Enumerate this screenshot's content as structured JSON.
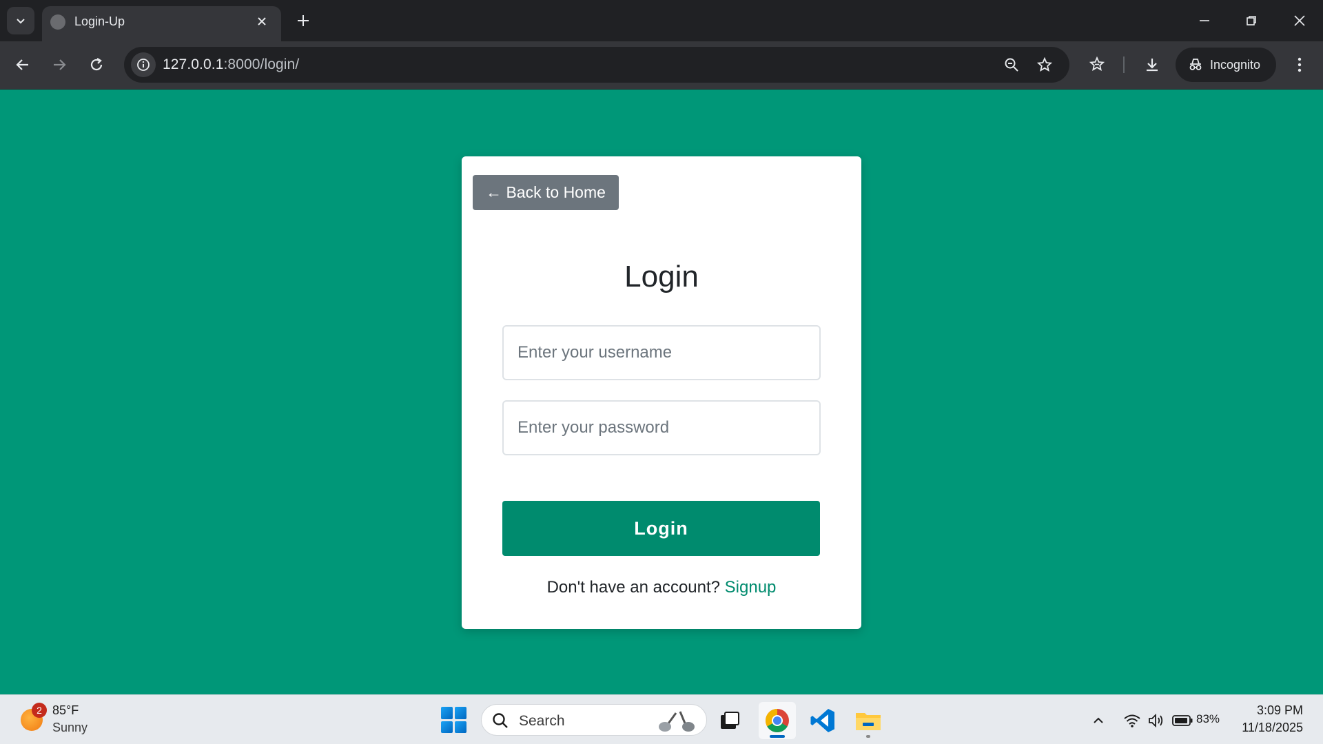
{
  "browser": {
    "tab_title": "Login-Up",
    "url_host": "127.0.0.1",
    "url_path": ":8000/login/",
    "incognito_label": "Incognito"
  },
  "page": {
    "background_color": "#009778",
    "back_button_label": "← Back to Home",
    "title": "Login",
    "username_placeholder": "Enter your username",
    "password_placeholder": "Enter your password",
    "submit_label": "Login",
    "signup_prompt": "Don't have an account? ",
    "signup_link": "Signup",
    "accent_color": "#008b6e"
  },
  "taskbar": {
    "weather_badge": "2",
    "weather_temp": "85°F",
    "weather_condition": "Sunny",
    "search_label": "Search",
    "battery_percent": "83%",
    "time": "3:09 PM",
    "date": "11/18/2025",
    "apps": [
      "task-view",
      "chrome",
      "vscode",
      "file-explorer"
    ]
  }
}
